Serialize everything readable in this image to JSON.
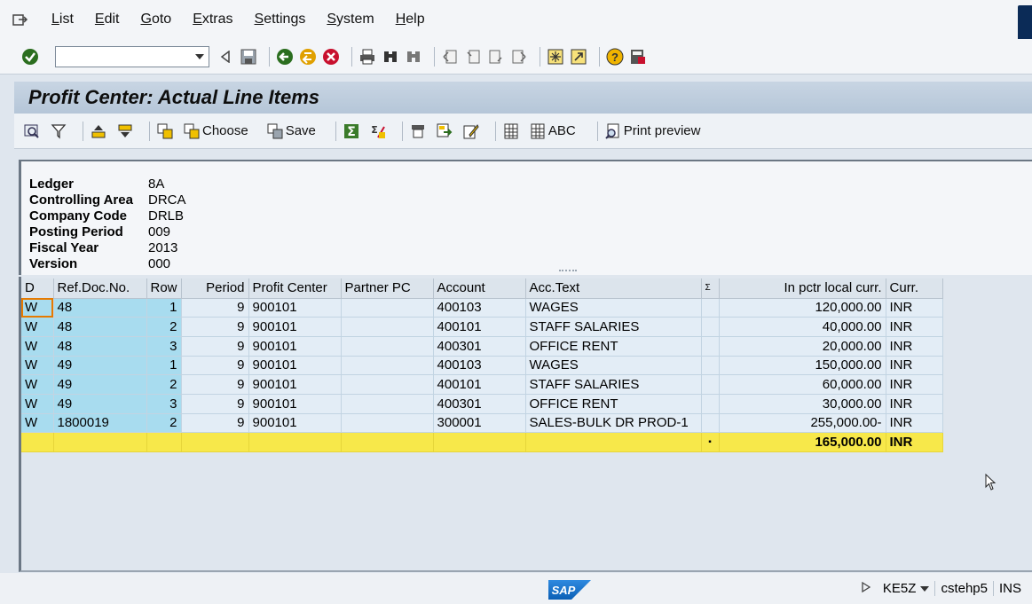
{
  "menu": [
    "List",
    "Edit",
    "Goto",
    "Extras",
    "Settings",
    "System",
    "Help"
  ],
  "title": "Profit Center: Actual Line Items",
  "app_toolbar": {
    "choose_label": "Choose",
    "save_label": "Save",
    "abc_label": "ABC",
    "print_preview_label": "Print preview"
  },
  "header": {
    "fields": [
      {
        "label": "Ledger",
        "value": "8A"
      },
      {
        "label": "Controlling Area",
        "value": "DRCA"
      },
      {
        "label": "Company Code",
        "value": "DRLB"
      },
      {
        "label": "Posting Period",
        "value": "009"
      },
      {
        "label": "Fiscal Year",
        "value": "2013"
      },
      {
        "label": "Version",
        "value": "000"
      }
    ]
  },
  "grid": {
    "columns": [
      "D",
      "Ref.Doc.No.",
      "Row",
      "Period",
      "Profit Center",
      "Partner PC",
      "Account",
      "Acc.Text",
      "Σ",
      "In pctr local curr.",
      "Curr."
    ],
    "rows": [
      [
        "W",
        "48",
        "1",
        "9",
        "900101",
        "",
        "400103",
        "WAGES",
        "",
        "120,000.00",
        "INR"
      ],
      [
        "W",
        "48",
        "2",
        "9",
        "900101",
        "",
        "400101",
        "STAFF SALARIES",
        "",
        "40,000.00",
        "INR"
      ],
      [
        "W",
        "48",
        "3",
        "9",
        "900101",
        "",
        "400301",
        "OFFICE RENT",
        "",
        "20,000.00",
        "INR"
      ],
      [
        "W",
        "49",
        "1",
        "9",
        "900101",
        "",
        "400103",
        "WAGES",
        "",
        "150,000.00",
        "INR"
      ],
      [
        "W",
        "49",
        "2",
        "9",
        "900101",
        "",
        "400101",
        "STAFF SALARIES",
        "",
        "60,000.00",
        "INR"
      ],
      [
        "W",
        "49",
        "3",
        "9",
        "900101",
        "",
        "400301",
        "OFFICE RENT",
        "",
        "30,000.00",
        "INR"
      ],
      [
        "W",
        "1800019",
        "2",
        "9",
        "900101",
        "",
        "300001",
        "SALES-BULK DR PROD-1",
        "",
        "255,000.00-",
        "INR"
      ]
    ],
    "total": {
      "marker": "▪",
      "amount": "165,000.00",
      "currency": "INR"
    }
  },
  "status": {
    "transaction": "KE5Z",
    "server": "cstehp5",
    "mode": "INS"
  },
  "colors": {
    "key_cell": "#a8dcef",
    "total_row": "#f7e84a",
    "title_bar": "#c8d5e3"
  }
}
